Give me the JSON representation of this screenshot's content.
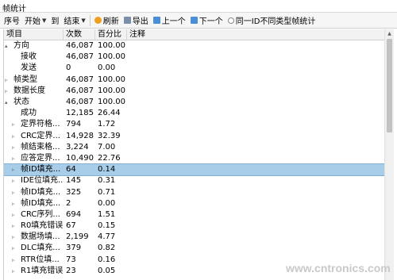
{
  "window": {
    "title": "帧统计"
  },
  "toolbar": {
    "seq_label": "序号",
    "start_label": "开始",
    "to_label": "到",
    "end_label": "结束",
    "refresh_label": "刷新",
    "export_label": "导出",
    "prev_label": "上一个",
    "next_label": "下一个",
    "option_label": "同一ID不同类型帧统计"
  },
  "table": {
    "columns": [
      "项目",
      "次数",
      "百分比",
      "注释"
    ],
    "rows": [
      {
        "name": "方向",
        "count": "46,087",
        "pct": "100.00",
        "note": "",
        "level": 1,
        "expander": "▴"
      },
      {
        "name": "接收",
        "count": "46,087",
        "pct": "100.00",
        "note": "",
        "level": 2,
        "expander": ""
      },
      {
        "name": "发送",
        "count": "0",
        "pct": "0.00",
        "note": "",
        "level": 2,
        "expander": ""
      },
      {
        "name": "帧类型",
        "count": "46,087",
        "pct": "100.00",
        "note": "",
        "level": 1,
        "expander": "▹"
      },
      {
        "name": "数据长度",
        "count": "46,087",
        "pct": "100.00",
        "note": "",
        "level": 1,
        "expander": "▹"
      },
      {
        "name": "状态",
        "count": "46,087",
        "pct": "100.00",
        "note": "",
        "level": 1,
        "expander": "▴"
      },
      {
        "name": "成功",
        "count": "12,185",
        "pct": "26.44",
        "note": "",
        "level": 2,
        "expander": ""
      },
      {
        "name": "定界符格...",
        "count": "794",
        "pct": "1.72",
        "note": "",
        "level": 2,
        "expander": "▹"
      },
      {
        "name": "CRC定界...",
        "count": "14,928",
        "pct": "32.39",
        "note": "",
        "level": 2,
        "expander": "▹"
      },
      {
        "name": "帧结束格...",
        "count": "3,224",
        "pct": "7.00",
        "note": "",
        "level": 2,
        "expander": "▹"
      },
      {
        "name": "应答定界...",
        "count": "10,490",
        "pct": "22.76",
        "note": "",
        "level": 2,
        "expander": "▹"
      },
      {
        "name": "帧ID填充...",
        "count": "64",
        "pct": "0.14",
        "note": "",
        "level": 2,
        "expander": "▹",
        "selected": true
      },
      {
        "name": "IDE位填充...",
        "count": "145",
        "pct": "0.31",
        "note": "",
        "level": 2,
        "expander": "▹"
      },
      {
        "name": "帧ID填充...",
        "count": "325",
        "pct": "0.71",
        "note": "",
        "level": 2,
        "expander": "▹"
      },
      {
        "name": "帧ID填充...",
        "count": "2",
        "pct": "0.00",
        "note": "",
        "level": 2,
        "expander": "▹"
      },
      {
        "name": "CRC序列...",
        "count": "694",
        "pct": "1.51",
        "note": "",
        "level": 2,
        "expander": "▹"
      },
      {
        "name": "R0填充错误",
        "count": "67",
        "pct": "0.15",
        "note": "",
        "level": 2,
        "expander": "▹"
      },
      {
        "name": "数据场填...",
        "count": "2,199",
        "pct": "4.77",
        "note": "",
        "level": 2,
        "expander": "▹"
      },
      {
        "name": "DLC填充...",
        "count": "379",
        "pct": "0.82",
        "note": "",
        "level": 2,
        "expander": "▹"
      },
      {
        "name": "RTR位填...",
        "count": "73",
        "pct": "0.16",
        "note": "",
        "level": 2,
        "expander": "▹"
      },
      {
        "name": "R1填充错误",
        "count": "23",
        "pct": "0.05",
        "note": "",
        "level": 2,
        "expander": "▹"
      }
    ]
  },
  "watermark": "www.cntronics.com",
  "colors": {
    "selection": "#a8cde8",
    "toolbar": "#f6f6f6",
    "header": "#f2f2f2"
  }
}
